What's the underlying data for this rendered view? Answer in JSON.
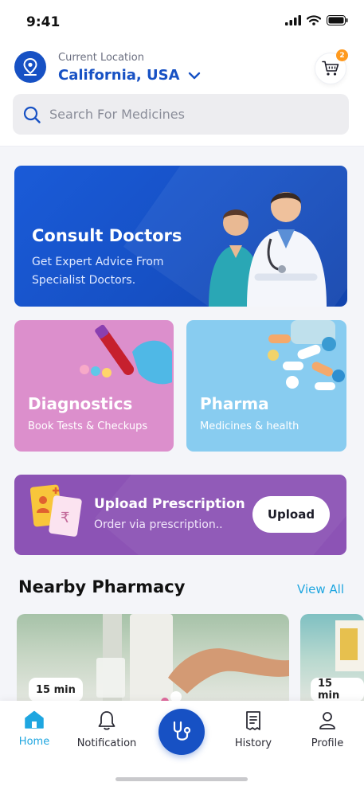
{
  "status_bar": {
    "time": "9:41"
  },
  "location": {
    "caption": "Current Location",
    "city": "California, USA"
  },
  "cart": {
    "badge_count": "2"
  },
  "search": {
    "placeholder": "Search For Medicines"
  },
  "consult": {
    "title": "Consult Doctors",
    "subtitle": "Get Expert Advice From Specialist Doctors."
  },
  "tiles": [
    {
      "title": "Diagnostics",
      "subtitle": "Book Tests & Checkups"
    },
    {
      "title": "Pharma",
      "subtitle": "Medicines & health"
    }
  ],
  "upload": {
    "title": "Upload Prescription",
    "subtitle": "Order via prescription..",
    "button_label": "Upload"
  },
  "nearby": {
    "title": "Nearby Pharmacy",
    "view_all": "View All",
    "cards": [
      {
        "eta": "15 min"
      },
      {
        "eta": "15 min"
      }
    ]
  },
  "bottom_nav": {
    "items": [
      {
        "label": "Home"
      },
      {
        "label": "Notification"
      },
      {
        "label": "History"
      },
      {
        "label": "Profile"
      }
    ]
  },
  "colors": {
    "primary": "#1751C4",
    "accent": "#1FA6E0",
    "diagnostics": "#DC8FCC",
    "pharma": "#88CCF0",
    "upload": "#8C53B5",
    "badge": "#FF9A1F"
  }
}
